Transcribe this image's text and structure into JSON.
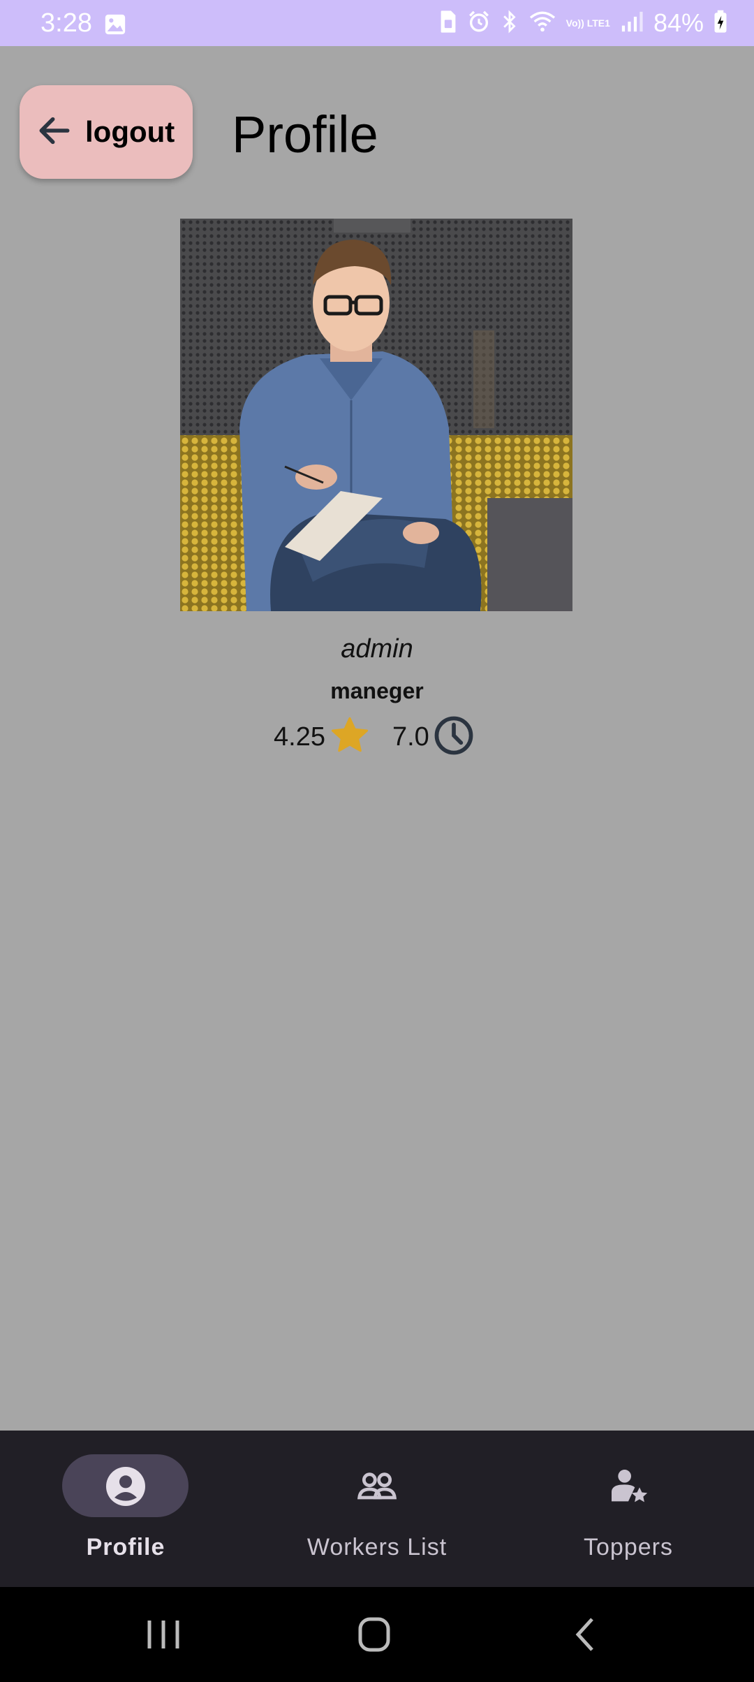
{
  "status_bar": {
    "time": "3:28",
    "battery_percent": "84%",
    "network_label": "Vo)) LTE1",
    "icons": [
      "gallery-icon",
      "sim-icon",
      "alarm-icon",
      "bluetooth-icon",
      "wifi-icon",
      "signal-icon",
      "battery-charging-icon"
    ]
  },
  "header": {
    "logout_label": "logout",
    "title": "Profile"
  },
  "profile": {
    "photo_description": "profile-photo",
    "name": "admin",
    "role": "maneger",
    "rating": "4.25",
    "hours": "7.0"
  },
  "bottom_nav": {
    "items": [
      {
        "label": "Profile",
        "icon": "account-circle-icon",
        "active": true
      },
      {
        "label": "Workers List",
        "icon": "group-icon",
        "active": false
      },
      {
        "label": "Toppers",
        "icon": "person-star-icon",
        "active": false
      }
    ]
  },
  "system_nav": {
    "buttons": [
      "recent-apps",
      "home",
      "back"
    ]
  },
  "colors": {
    "background": "#a6a6a6",
    "status_bar": "#cdbdfa",
    "logout_button": "#ebbdbd",
    "nav_bar": "#211f26",
    "nav_pill": "#4a4458",
    "star": "#dda625"
  }
}
